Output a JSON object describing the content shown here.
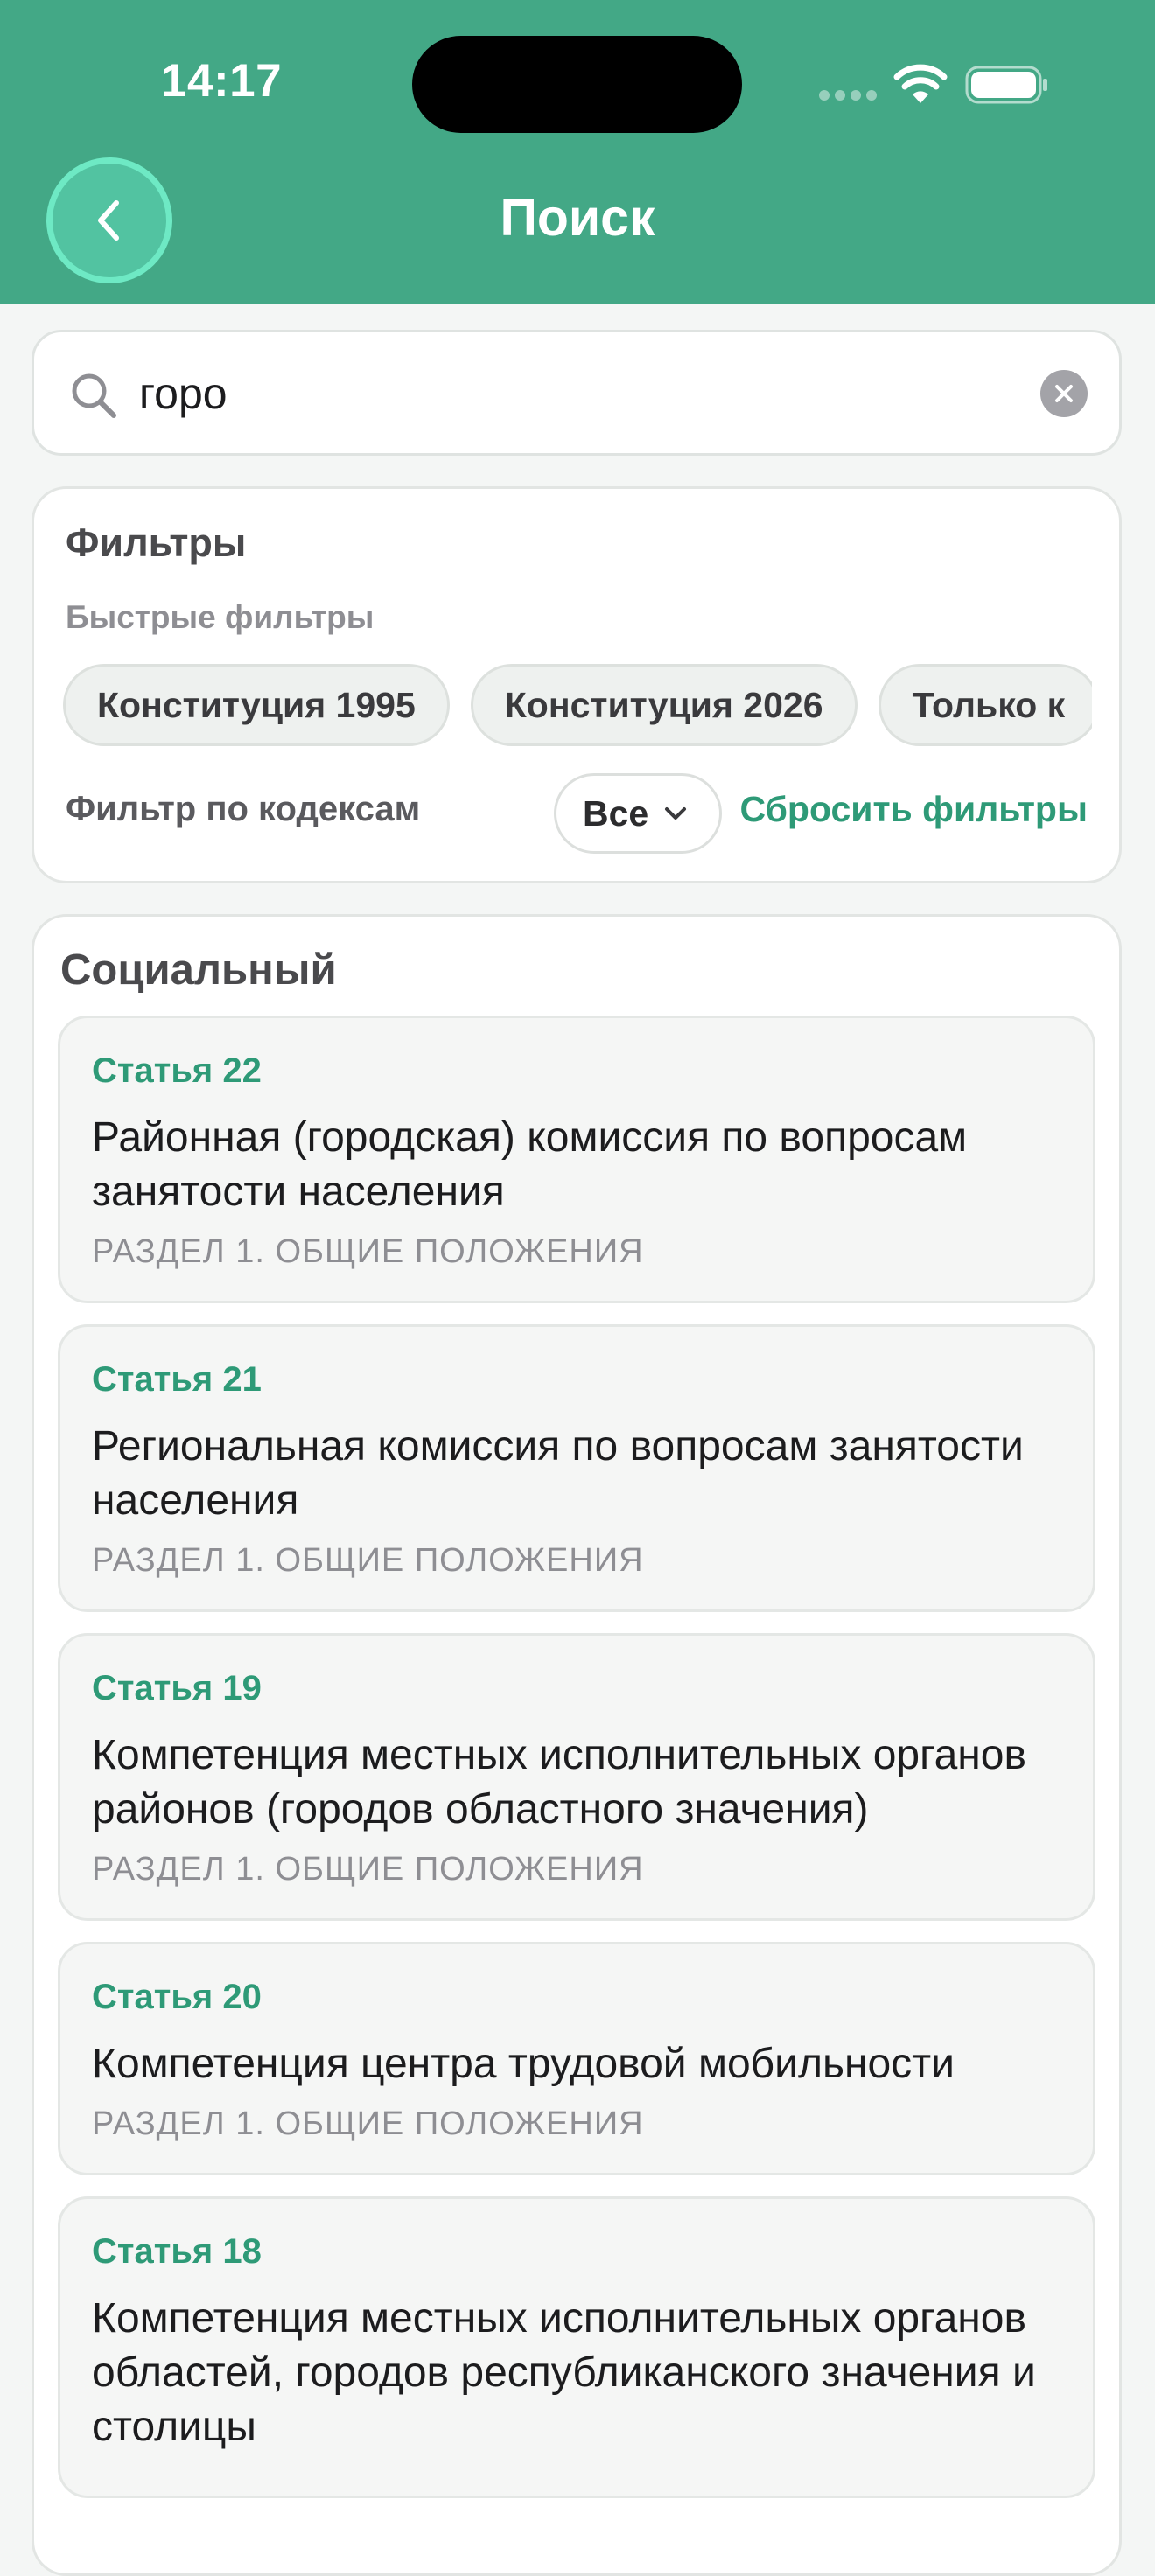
{
  "status_bar": {
    "time": "14:17"
  },
  "header": {
    "title": "Поиск",
    "back_icon": "chevron-left-icon"
  },
  "search": {
    "value": "горо",
    "icon": "search-icon",
    "clear_icon": "close-circle-icon"
  },
  "filters": {
    "title": "Фильтры",
    "quick_label": "Быстрые фильтры",
    "chips": [
      "Конституция 1995",
      "Конституция 2026",
      "Только к"
    ],
    "codex_label": "Фильтр по кодексам",
    "codex_value": "Все",
    "reset_label": "Сбросить фильтры"
  },
  "results": {
    "section_title": "Социальный",
    "items": [
      {
        "article": "Статья 22",
        "title": "Районная (городская) комиссия по вопросам занятости населения",
        "section": "РАЗДЕЛ 1. ОБЩИЕ ПОЛОЖЕНИЯ"
      },
      {
        "article": "Статья 21",
        "title": "Региональная комиссия по вопросам занятости населения",
        "section": "РАЗДЕЛ 1. ОБЩИЕ ПОЛОЖЕНИЯ"
      },
      {
        "article": "Статья 19",
        "title": "Компетенция местных исполнительных органов районов (городов областного значения)",
        "section": "РАЗДЕЛ 1. ОБЩИЕ ПОЛОЖЕНИЯ"
      },
      {
        "article": "Статья 20",
        "title": "Компетенция центра трудовой мобильности",
        "section": "РАЗДЕЛ 1. ОБЩИЕ ПОЛОЖЕНИЯ"
      },
      {
        "article": "Статья 18",
        "title": "Компетенция местных исполнительных органов областей, городов республиканского значения и столицы",
        "section": ""
      }
    ]
  },
  "colors": {
    "header": "#43a886",
    "accent": "#2e9a77",
    "back_button": "#52c3a1"
  }
}
